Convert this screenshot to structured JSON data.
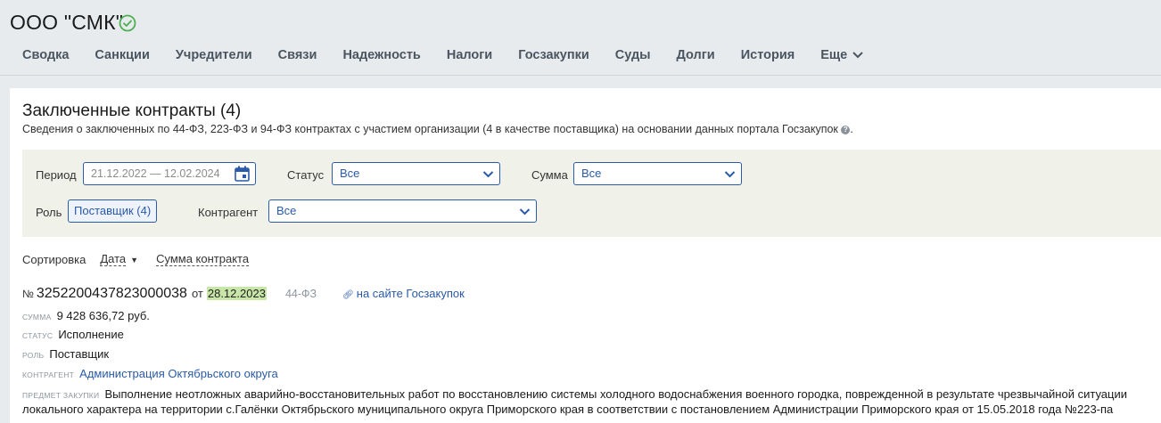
{
  "company": {
    "name": "ООО \"СМК\"",
    "verified_icon": "check-circle-icon",
    "verified_color": "#4caf50"
  },
  "tabs": [
    {
      "label": "Сводка"
    },
    {
      "label": "Санкции"
    },
    {
      "label": "Учредители"
    },
    {
      "label": "Связи"
    },
    {
      "label": "Надежность"
    },
    {
      "label": "Налоги"
    },
    {
      "label": "Госзакупки"
    },
    {
      "label": "Суды"
    },
    {
      "label": "Долги"
    },
    {
      "label": "История"
    },
    {
      "label": "Еще"
    }
  ],
  "section": {
    "title": "Заключенные контракты (4)",
    "subtitle": "Сведения о заключенных по 44-ФЗ, 223-ФЗ и 94-ФЗ контрактах с участием организации (4 в качестве поставщика) на основании данных портала Госзакупок",
    "subtitle_end": "."
  },
  "filters": {
    "period_label": "Период",
    "period_value": "21.12.2022 — 12.02.2024",
    "status_label": "Статус",
    "status_value": "Все",
    "sum_label": "Сумма",
    "sum_value": "Все",
    "role_label": "Роль",
    "role_value": "Поставщик (4)",
    "counterparty_label": "Контрагент",
    "counterparty_value": "Все"
  },
  "sort": {
    "label": "Сортировка",
    "by_date": "Дата",
    "by_sum": "Сумма контракта"
  },
  "contract": {
    "no_sign": "№",
    "number": "3252200437823000038",
    "from": "от",
    "date": "28.12.2023",
    "law": "44-ФЗ",
    "gz_link": "на сайте Госзакупок",
    "sum_label": "сумма",
    "sum_value": "9 428 636,72 руб.",
    "status_label": "статус",
    "status_value": "Исполнение",
    "role_label": "роль",
    "role_value": "Поставщик",
    "counterparty_label": "контрагент",
    "counterparty_value": "Администрация Октябрьского округа",
    "subject_label": "предмет закупки",
    "subject_value": "Выполнение неотложных аварийно-восстановительных работ по восстановлению системы холодного водоснабжения военного городка, поврежденной в результате чрезвычайной ситуации локального характера на территории с.Галёнки Октябрьского муниципального округа Приморского края в соответствии с постановлением Администрации Приморского края от 15.05.2018 года №223-па"
  },
  "colors": {
    "accent": "#2a5aa8",
    "date_highlight": "#c8e6a8",
    "filter_bg": "#f0f1e8",
    "page_bg": "#e8ebee"
  }
}
